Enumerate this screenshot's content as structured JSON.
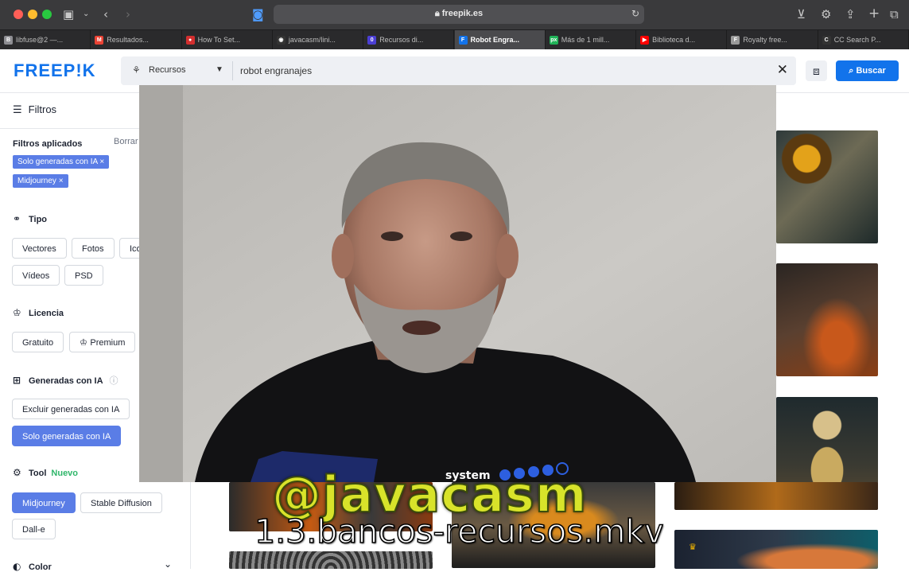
{
  "browser": {
    "url": "freepik.es",
    "tabs": [
      {
        "label": "libfuse@2 —...",
        "fav": "B",
        "color": "#8e8e93"
      },
      {
        "label": "Resultados...",
        "fav": "M",
        "color": "#ea4335"
      },
      {
        "label": "How To Set...",
        "fav": "●",
        "color": "#d32f2f"
      },
      {
        "label": "javacasm/lini...",
        "fav": "◉",
        "color": "#333333"
      },
      {
        "label": "Recursos di...",
        "fav": "0",
        "color": "#4b3fd4"
      },
      {
        "label": "Robot Engra...",
        "fav": "F",
        "color": "#1273eb",
        "active": true
      },
      {
        "label": "Más de 1 mill...",
        "fav": "px",
        "color": "#20b358"
      },
      {
        "label": "Biblioteca d...",
        "fav": "▶",
        "color": "#ff0000"
      },
      {
        "label": "Royalty free...",
        "fav": "F",
        "color": "#9a9a9a"
      },
      {
        "label": "CC Search P...",
        "fav": "C",
        "color": "#333333"
      }
    ]
  },
  "header": {
    "logo": "FREEP!K",
    "resource_type": "Recursos",
    "query": "robot engranajes",
    "search_button": "Buscar"
  },
  "sidebar": {
    "title": "Filtros",
    "applied_title": "Filtros aplicados",
    "clear_label": "Borrar",
    "applied_chips": [
      "Solo generadas con IA ×",
      "Midjourney ×"
    ],
    "tipo": {
      "title": "Tipo",
      "options": [
        "Vectores",
        "Fotos",
        "Ico",
        "Vídeos",
        "PSD"
      ]
    },
    "licencia": {
      "title": "Licencia",
      "options": [
        "Gratuito",
        "Premium"
      ]
    },
    "ia": {
      "title": "Generadas con IA",
      "options": [
        "Excluir generadas con IA",
        "Solo generadas con IA"
      ]
    },
    "tool": {
      "title": "Tool",
      "badge": "Nuevo",
      "options": [
        "Midjourney",
        "Stable Diffusion",
        "Dall-e"
      ]
    },
    "color": {
      "title": "Color"
    }
  },
  "watermark": {
    "handle": "@javacasm",
    "filename": "1.3.bancos-recursos.mkv"
  },
  "colors": {
    "brand": "#1273eb",
    "chip": "#5a7de6",
    "nuevo": "#2fb66a"
  }
}
